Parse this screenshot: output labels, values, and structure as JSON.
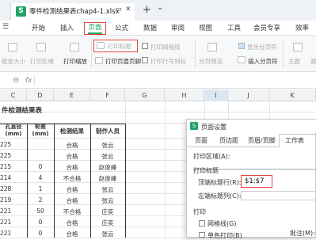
{
  "titlebar": {
    "doc_title": "零件检测结果表chap4-1.xlsx",
    "add_tab": "+",
    "chevron": "⌄"
  },
  "menu": {
    "items": [
      "开始",
      "插入",
      "页面",
      "公式",
      "数据",
      "审阅",
      "视图",
      "工具",
      "会员专享",
      "效率"
    ],
    "active": "页面"
  },
  "ribbon": {
    "print_title": "打印标题",
    "print_gridlines": "打印网格线",
    "print_header_footer": "打印页眉页脚",
    "print_row_col_header": "打印行号列标",
    "page_break_preview": "分页预览",
    "show_page_break": "显示分页符",
    "insert_page_break": "插入分页符",
    "theme": "主题",
    "paper_size": "纸张大小",
    "print_area": "打印区域",
    "print_zoom": "打印缩放",
    "truncated_left": "面"
  },
  "formula_bar": {
    "zoom_icon": "⊖",
    "fx": "fx"
  },
  "grid": {
    "columns": [
      "C",
      "D",
      "E",
      "F",
      "G",
      "H",
      "I",
      "J",
      "K"
    ],
    "sheet_title": "件检测结果表",
    "headers": [
      "孔直径\n(mm)",
      "轮差\n(mm)",
      "检测结果",
      "制作人员"
    ],
    "rows": [
      [
        "225",
        "",
        "合格",
        "张云"
      ],
      [
        "225",
        "",
        "合格",
        "张云"
      ],
      [
        "215",
        "0",
        "合格",
        "赵俊峰"
      ],
      [
        "214",
        "4",
        "不合格",
        "赵俊峰"
      ],
      [
        "228",
        "1",
        "合格",
        "张云"
      ],
      [
        "219",
        "2",
        "合格",
        "张云"
      ],
      [
        "221",
        "50",
        "不合格",
        "庄奕"
      ],
      [
        "221",
        "0",
        "合格",
        "庄奕"
      ],
      [
        "221",
        "0",
        "合格",
        "张云"
      ]
    ]
  },
  "dialog": {
    "title": "页面设置",
    "tabs": [
      "页面",
      "页边距",
      "页眉/页脚",
      "工作表"
    ],
    "active_tab": "工作表",
    "print_area_label": "打印区域(A):",
    "print_titles_section": "打印标题",
    "top_rows_label": "顶端标题行(R):",
    "top_rows_value": "$1:$7",
    "left_cols_label": "左端标题列(C):",
    "print_section": "打印",
    "gridlines_label": "网格线(G)",
    "mono_label": "单色打印(B)",
    "comments_label": "批注(M):"
  },
  "colors": {
    "accent_green": "#20a464",
    "highlight_red": "#e0483d"
  }
}
